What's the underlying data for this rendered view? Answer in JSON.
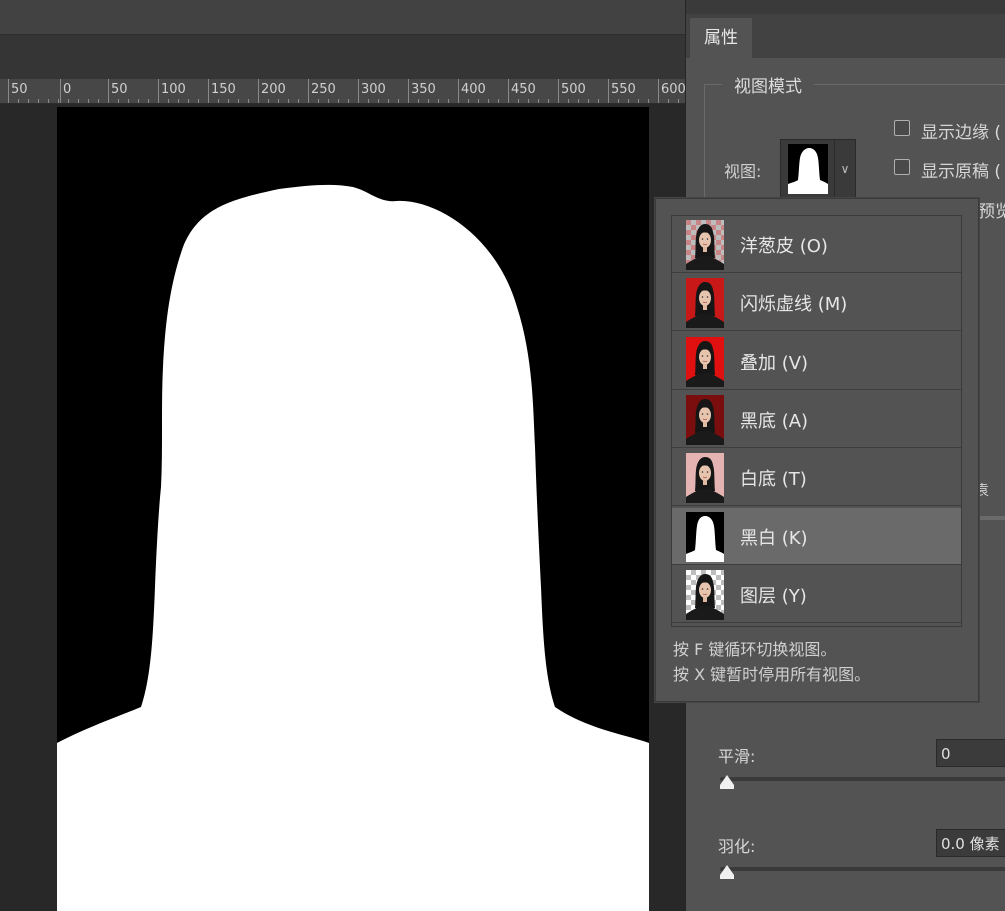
{
  "ruler": {
    "ticks": [
      "50",
      "0",
      "50",
      "100",
      "150",
      "200",
      "250",
      "300",
      "350",
      "400",
      "450",
      "500",
      "550",
      "600"
    ]
  },
  "panel": {
    "tab": "属性",
    "view_mode_title": "视图模式",
    "view_label": "视图:",
    "checkboxes": [
      {
        "label": "显示边缘 (",
        "checked": false
      },
      {
        "label": "显示原稿 (",
        "checked": false
      }
    ],
    "preview_fragment": "预览",
    "fragment_right": "袁",
    "smooth": {
      "label": "平滑:",
      "value": "0",
      "slider_fraction": 0
    },
    "feather": {
      "label": "羽化:",
      "value": "0.0 像素",
      "slider_fraction": 0
    }
  },
  "view_menu": {
    "items": [
      {
        "label": "洋葱皮 (O)",
        "thumb_bg": "#c98585",
        "checker": true
      },
      {
        "label": "闪烁虚线 (M)",
        "thumb_bg": "#c81818",
        "checker": false
      },
      {
        "label": "叠加 (V)",
        "thumb_bg": "#e01010",
        "checker": false
      },
      {
        "label": "黑底 (A)",
        "thumb_bg": "#7a0e0e",
        "checker": false
      },
      {
        "label": "白底 (T)",
        "thumb_bg": "#e6b3b3",
        "checker": false
      },
      {
        "label": "黑白 (K)",
        "thumb_bg": "#000000",
        "checker": false,
        "selected": true,
        "mask": true
      },
      {
        "label": "图层 (Y)",
        "thumb_bg": "#ffffff",
        "checker": true
      }
    ],
    "hints": [
      "按 F 键循环切换视图。",
      "按 X 键暂时停用所有视图。"
    ]
  }
}
